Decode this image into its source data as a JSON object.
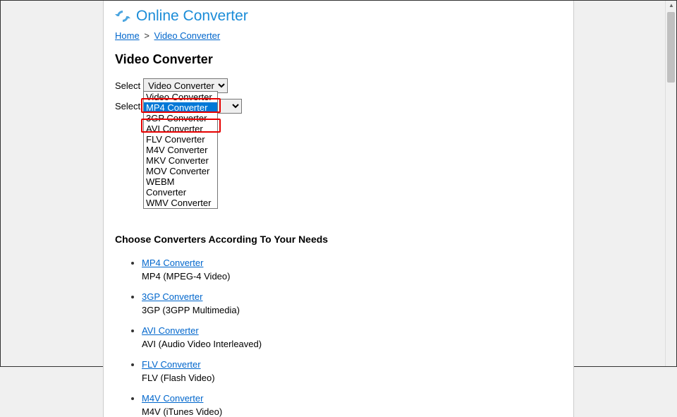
{
  "site": {
    "title": "Online Converter"
  },
  "breadcrumb": {
    "home": "Home",
    "sep": ">",
    "current": "Video Converter"
  },
  "page": {
    "title": "Video Converter",
    "select_label": "Select",
    "select1_value": "Video Converter",
    "sub_title": "Choose Converters According To Your Needs"
  },
  "dropdown": {
    "options": [
      "Video Converter",
      "MP4 Converter",
      "3GP Converter",
      "AVI Converter",
      "FLV Converter",
      "M4V Converter",
      "MKV Converter",
      "MOV Converter",
      "WEBM Converter",
      "WMV Converter"
    ]
  },
  "converters": [
    {
      "name": "MP4 Converter",
      "desc": "MP4 (MPEG-4 Video)"
    },
    {
      "name": "3GP Converter",
      "desc": "3GP (3GPP Multimedia)"
    },
    {
      "name": "AVI Converter",
      "desc": "AVI (Audio Video Interleaved)"
    },
    {
      "name": "FLV Converter",
      "desc": "FLV (Flash Video)"
    },
    {
      "name": "M4V Converter",
      "desc": "M4V (iTunes Video)"
    }
  ]
}
